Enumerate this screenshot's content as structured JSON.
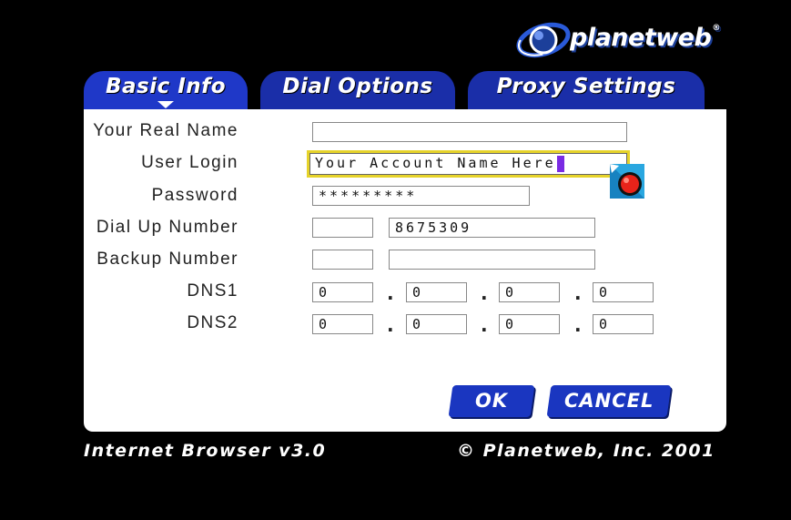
{
  "brand": {
    "name": "planetweb",
    "trademark": "®"
  },
  "tabs": [
    {
      "label": "Basic Info",
      "active": true
    },
    {
      "label": "Dial Options",
      "active": false
    },
    {
      "label": "Proxy Settings",
      "active": false
    }
  ],
  "form": {
    "real_name": {
      "label": "Your Real Name",
      "value": ""
    },
    "user_login": {
      "label": "User Login",
      "value": "Your Account Name Here"
    },
    "password": {
      "label": "Password",
      "value": "*********"
    },
    "dial_up": {
      "label": "Dial Up Number",
      "area_code": "",
      "number": "8675309"
    },
    "backup": {
      "label": "Backup Number",
      "area_code": "",
      "number": ""
    },
    "dns1": {
      "label": "DNS1",
      "octets": [
        "0",
        "0",
        "0",
        "0"
      ]
    },
    "dns2": {
      "label": "DNS2",
      "octets": [
        "0",
        "0",
        "0",
        "0"
      ]
    },
    "dns_separator": "."
  },
  "buttons": {
    "ok": "OK",
    "cancel": "CANCEL"
  },
  "footer": {
    "left": "Internet Browser v3.0",
    "right": "© Planetweb, Inc. 2001"
  },
  "colors": {
    "background": "#000000",
    "tab": "#1a2ea8",
    "button": "#1a36c0",
    "focus_border": "#e6d32a",
    "caret": "#7a2be3"
  },
  "icons": [
    "planetweb-logo-icon",
    "pointer-cursor-icon",
    "tab-caret-icon"
  ]
}
